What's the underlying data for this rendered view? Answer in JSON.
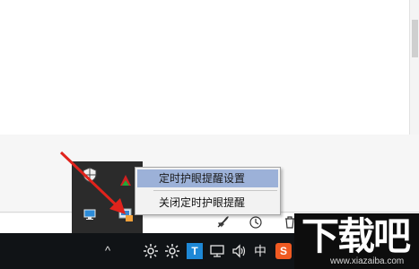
{
  "context_menu": {
    "items": [
      {
        "label": "定时护眼提醒设置",
        "highlighted": true
      },
      {
        "label": "关闭定时护眼提醒",
        "highlighted": false
      }
    ]
  },
  "taskbar": {
    "overflow_chevron": "^",
    "language_indicator": "中",
    "tray_app_letter": "T",
    "ime_letter": "S"
  },
  "icons": [
    "security-shield-icon",
    "red-green-triangle-icon",
    "monitor-icon",
    "eye-reminder-tray-icon",
    "red-arrow-icon",
    "rocket-icon",
    "clock-icon",
    "trash-icon",
    "settings-icon",
    "network-icon",
    "volume-icon"
  ],
  "watermark": {
    "main_text": "下载吧",
    "sub_text": "www.xiazaiba.com"
  },
  "colors": {
    "taskbar": "#101316",
    "tray_overflow": "#2b2b2b",
    "menu_highlight": "#9cb1d8",
    "arrow": "#e0231c",
    "tray_app_blue": "#1e88d6",
    "ime_orange": "#f05a22"
  }
}
